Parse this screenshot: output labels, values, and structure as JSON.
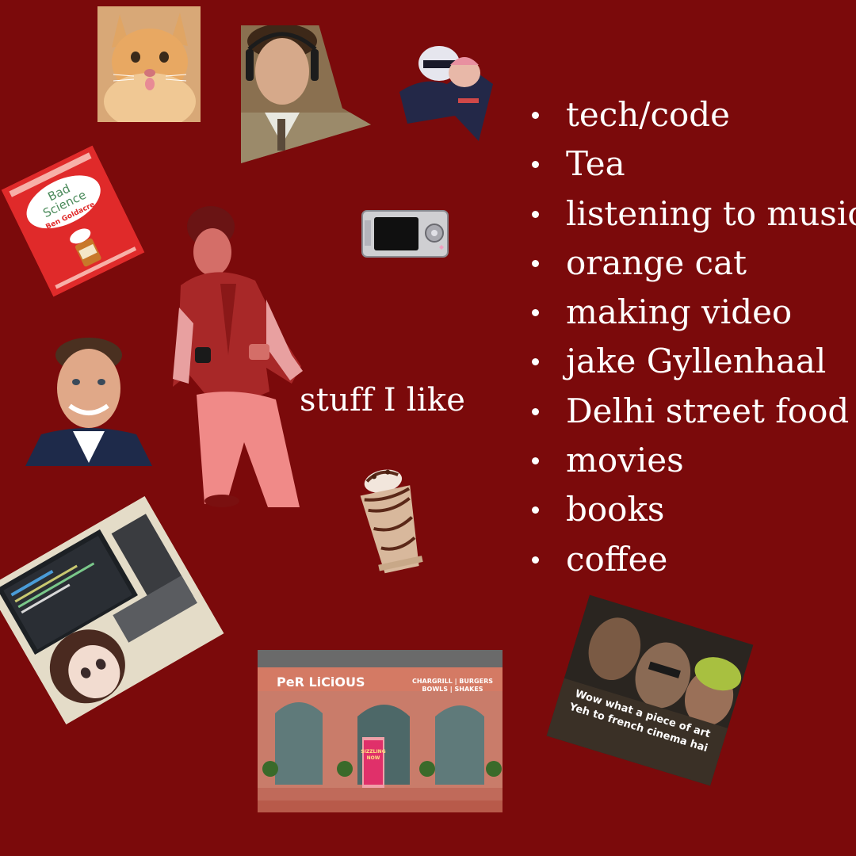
{
  "caption": "stuff I like",
  "likes": [
    "tech/code",
    "Tea",
    "listening to music",
    "orange cat",
    "making video",
    "jake Gyllenhaal",
    "Delhi street food",
    "movies",
    "books",
    "coffee"
  ],
  "book": {
    "title_line1": "Bad",
    "title_line2": "Science",
    "author": "Ben Goldacre"
  },
  "restaurant": {
    "name": "PeR LiCiOUS",
    "sign_line1": "CHARGRILL | BURGERS",
    "sign_line2": "BOWLS | SHAKES",
    "board_line1": "SIZZLING",
    "board_line2": "NOW"
  },
  "meme": {
    "line1": "Wow what a piece of art",
    "line2": "Yeh to french cinema hai"
  },
  "colors": {
    "background": "#7b0a0b",
    "text": "#ffffff"
  }
}
